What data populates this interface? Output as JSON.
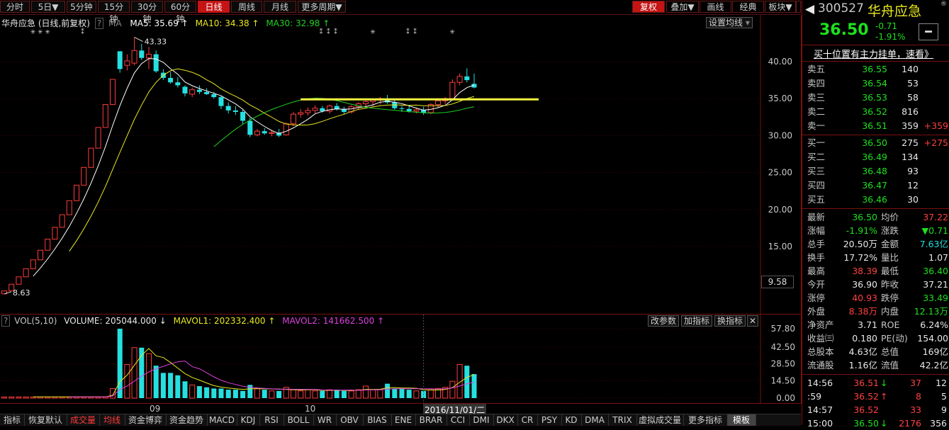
{
  "toolbar": {
    "periods": [
      "分时",
      "5日▼",
      "5分钟",
      "15分钟",
      "30分钟",
      "60分钟",
      "日线",
      "周线",
      "月线",
      "更多周期▼"
    ],
    "active_period": "日线",
    "right_buttons": [
      "复权",
      "叠加▼",
      "画线",
      "经典",
      "板块▼"
    ],
    "nav_arrows": [
      "◀",
      "▶"
    ]
  },
  "main_legend": {
    "name": "华舟应急 (日线,前复权)",
    "help": "?",
    "ma_label": "MA",
    "ma5": "MA5: 35.69",
    "ma10": "MA10: 34.38",
    "ma30": "MA30: 32.98",
    "setting_button": "设置均线",
    "high_marker": "43.33",
    "low_marker": "8.63",
    "corner_box": "9.58"
  },
  "vol_legend": {
    "name": "VOL(5,10)",
    "volume": "VOLUME: 205044.000",
    "mavol1": "MAVOL1: 202332.400",
    "mavol2": "MAVOL2: 141662.500",
    "buttons": [
      "改参数",
      "加指标",
      "换指标"
    ]
  },
  "price_axis": [
    "40.00",
    "35.00",
    "30.00",
    "25.00",
    "20.00",
    "15.00"
  ],
  "vol_axis": [
    "57.80",
    "42.50",
    "28.50",
    "14.50",
    "0.00"
  ],
  "date_labels": [
    "09",
    "10"
  ],
  "cursor_date": "2016/11/01/二",
  "bottom_tabs": [
    "指标",
    "恢复默认",
    "成交量",
    "均线",
    "资金博弈",
    "资金趋势",
    "MACD",
    "KDJ",
    "RSI",
    "BOLL",
    "WR",
    "OBV",
    "BIAS",
    "ENE",
    "BRAR",
    "CCI",
    "DMI",
    "DKX",
    "CR",
    "PSY",
    "KD",
    "DMA",
    "TRIX",
    "虚拟成交量",
    "更多指标",
    "模板"
  ],
  "panel": {
    "code": "300527",
    "name": "华舟应急",
    "price": "36.50",
    "change": "-0.71",
    "change_pct": "-1.91%",
    "banner": "买十位置有主力挂单，速看》",
    "asks": [
      {
        "label": "卖五",
        "price": "36.55",
        "vol": "140",
        "delta": ""
      },
      {
        "label": "卖四",
        "price": "36.54",
        "vol": "53",
        "delta": ""
      },
      {
        "label": "卖三",
        "price": "36.53",
        "vol": "58",
        "delta": ""
      },
      {
        "label": "卖二",
        "price": "36.52",
        "vol": "816",
        "delta": ""
      },
      {
        "label": "卖一",
        "price": "36.51",
        "vol": "359",
        "delta": "+359"
      }
    ],
    "bids": [
      {
        "label": "买一",
        "price": "36.50",
        "vol": "275",
        "delta": "+275"
      },
      {
        "label": "买二",
        "price": "36.49",
        "vol": "134",
        "delta": ""
      },
      {
        "label": "买三",
        "price": "36.48",
        "vol": "93",
        "delta": ""
      },
      {
        "label": "买四",
        "price": "36.47",
        "vol": "12",
        "delta": ""
      },
      {
        "label": "买五",
        "price": "36.46",
        "vol": "30",
        "delta": ""
      }
    ],
    "stats": [
      [
        "最新",
        "36.50",
        "均价",
        "37.22"
      ],
      [
        "涨幅",
        "-1.91%",
        "涨跌",
        "▼0.71"
      ],
      [
        "总手",
        "20.50万",
        "金额",
        "7.63亿"
      ],
      [
        "换手",
        "17.72%",
        "量比",
        "1.07"
      ],
      [
        "最高",
        "38.39",
        "最低",
        "36.40"
      ],
      [
        "今开",
        "36.90",
        "昨收",
        "37.21"
      ],
      [
        "涨停",
        "40.93",
        "跌停",
        "33.49"
      ],
      [
        "外盘",
        "8.38万",
        "内盘",
        "12.13万"
      ],
      [
        "净资产",
        "3.71",
        "ROE",
        "6.24%"
      ],
      [
        "收益㈢",
        "0.180",
        "PE(动)",
        "154.00"
      ],
      [
        "总股本",
        "4.63亿",
        "总值",
        "169亿"
      ],
      [
        "流通股",
        "1.16亿",
        "流值",
        "42.2亿"
      ]
    ],
    "ticks": [
      [
        "14:56",
        "36.51",
        "↓",
        "37",
        "12"
      ],
      [
        ":59",
        "36.52",
        "↑",
        "8",
        "5"
      ],
      [
        "14:57",
        "36.52",
        "",
        "33",
        "9"
      ],
      [
        "15:00",
        "36.50",
        "↓",
        "2176",
        "356"
      ]
    ]
  },
  "colors": {
    "up": "#ff3c3c",
    "down": "#26e0e0",
    "ma5": "#ffffff",
    "ma10": "#e8e820",
    "ma30": "#20d020",
    "mavol2": "#e040e0",
    "resistance": "#f0f040"
  },
  "chart_data": {
    "type": "candlestick",
    "candles": [
      [
        8.6,
        9.0,
        8.6,
        9.0
      ],
      [
        9.0,
        9.9,
        9.0,
        9.9
      ],
      [
        9.9,
        10.9,
        9.9,
        10.9
      ],
      [
        10.9,
        12.0,
        10.9,
        12.0
      ],
      [
        12.0,
        13.2,
        12.0,
        13.2
      ],
      [
        13.2,
        14.5,
        13.2,
        14.5
      ],
      [
        14.5,
        16.0,
        14.5,
        16.0
      ],
      [
        16.0,
        17.6,
        16.0,
        17.6
      ],
      [
        17.6,
        19.3,
        17.6,
        19.3
      ],
      [
        19.3,
        21.2,
        19.3,
        21.2
      ],
      [
        21.2,
        23.3,
        21.2,
        23.3
      ],
      [
        23.3,
        25.7,
        23.3,
        25.7
      ],
      [
        25.7,
        28.3,
        25.7,
        28.3
      ],
      [
        28.3,
        31.1,
        28.3,
        31.1
      ],
      [
        31.1,
        34.2,
        31.1,
        34.2
      ],
      [
        34.2,
        37.6,
        34.2,
        37.6
      ],
      [
        41.4,
        41.4,
        38.5,
        39.0
      ],
      [
        39.5,
        41.0,
        38.8,
        40.1
      ],
      [
        39.8,
        43.3,
        39.5,
        41.5
      ],
      [
        41.5,
        42.4,
        40.2,
        40.5
      ],
      [
        40.5,
        42.0,
        39.0,
        41.0
      ],
      [
        41.0,
        41.5,
        38.5,
        38.7
      ],
      [
        38.5,
        39.0,
        37.5,
        37.8
      ],
      [
        37.8,
        38.6,
        37.0,
        37.2
      ],
      [
        37.2,
        37.9,
        36.5,
        36.8
      ],
      [
        36.6,
        36.8,
        35.3,
        35.7
      ],
      [
        35.6,
        36.5,
        35.2,
        36.2
      ],
      [
        36.2,
        36.8,
        35.6,
        35.9
      ],
      [
        35.9,
        36.4,
        35.5,
        35.6
      ],
      [
        35.6,
        35.9,
        35.0,
        35.2
      ],
      [
        35.2,
        35.4,
        33.6,
        34.0
      ],
      [
        34.0,
        34.5,
        33.0,
        33.4
      ],
      [
        33.4,
        34.0,
        32.8,
        33.2
      ],
      [
        33.2,
        33.5,
        31.5,
        32.0
      ],
      [
        32.0,
        32.4,
        29.8,
        30.1
      ],
      [
        30.1,
        30.9,
        29.9,
        30.6
      ],
      [
        30.6,
        31.0,
        30.1,
        30.3
      ],
      [
        30.3,
        30.8,
        29.9,
        30.4
      ],
      [
        30.4,
        30.9,
        29.8,
        30.0
      ],
      [
        30.1,
        31.8,
        30.0,
        31.6
      ],
      [
        31.6,
        33.2,
        31.3,
        32.9
      ],
      [
        32.9,
        33.6,
        32.4,
        33.1
      ],
      [
        33.1,
        33.8,
        32.7,
        33.4
      ],
      [
        33.4,
        34.1,
        33.0,
        33.7
      ],
      [
        33.7,
        34.0,
        33.1,
        33.3
      ],
      [
        33.3,
        34.2,
        33.0,
        34.0
      ],
      [
        34.0,
        34.4,
        33.4,
        33.6
      ],
      [
        33.6,
        33.9,
        32.9,
        33.2
      ],
      [
        33.2,
        34.1,
        33.0,
        33.9
      ],
      [
        33.9,
        34.5,
        33.5,
        34.3
      ],
      [
        34.3,
        34.8,
        33.8,
        34.6
      ],
      [
        34.6,
        35.0,
        33.9,
        34.8
      ],
      [
        34.8,
        35.2,
        34.2,
        35.0
      ],
      [
        35.0,
        35.5,
        34.3,
        34.5
      ],
      [
        34.5,
        34.8,
        33.5,
        33.7
      ],
      [
        33.7,
        34.0,
        33.2,
        33.6
      ],
      [
        33.6,
        34.0,
        33.1,
        33.3
      ],
      [
        33.3,
        33.8,
        33.0,
        33.5
      ],
      [
        33.5,
        33.9,
        32.8,
        33.1
      ],
      [
        33.1,
        34.4,
        32.9,
        34.2
      ],
      [
        34.2,
        34.9,
        33.8,
        34.7
      ],
      [
        34.7,
        35.2,
        34.3,
        35.0
      ],
      [
        35.0,
        37.6,
        34.9,
        37.2
      ],
      [
        37.2,
        38.4,
        36.8,
        38.0
      ],
      [
        38.0,
        39.1,
        37.2,
        37.5
      ],
      [
        37.0,
        38.4,
        36.4,
        36.5
      ]
    ],
    "volumes": [
      1,
      1,
      1,
      1,
      1,
      1,
      1,
      1,
      1,
      1,
      1,
      1,
      1,
      1,
      1,
      8,
      57.8,
      28,
      42,
      42,
      37,
      27,
      21,
      21,
      19,
      14,
      11,
      10,
      9,
      8,
      8,
      7,
      7,
      6,
      11,
      8,
      7,
      6,
      6,
      9,
      7,
      6,
      7,
      6,
      6,
      7,
      7,
      6,
      6,
      7,
      10,
      7,
      7,
      12,
      8,
      8,
      7,
      6,
      6,
      7,
      8,
      9,
      14,
      28,
      27,
      20
    ],
    "resistance_level": 34.9,
    "ylim": [
      8,
      44
    ],
    "vol_ylim": [
      0,
      57.8
    ]
  }
}
